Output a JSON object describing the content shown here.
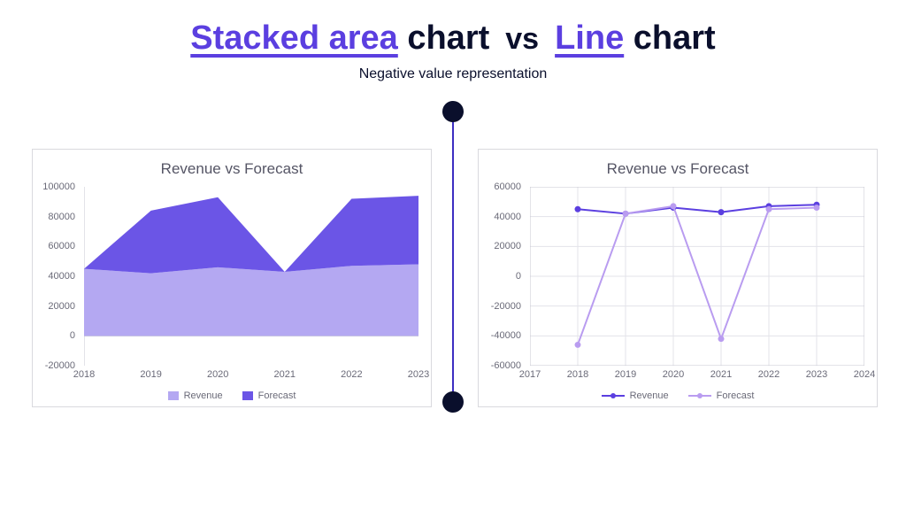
{
  "heading": {
    "left_link": "Stacked area",
    "left_rest": " chart",
    "vs": "vs",
    "right_link": "Line",
    "right_rest": " chart",
    "subtitle": "Negative value representation"
  },
  "chart_data": [
    {
      "type": "area",
      "title": "Revenue vs Forecast",
      "categories": [
        "2018",
        "2019",
        "2020",
        "2021",
        "2022",
        "2023"
      ],
      "series": [
        {
          "name": "Revenue",
          "values": [
            45000,
            42000,
            46000,
            43000,
            47000,
            48000
          ],
          "color": "#b4a8f2"
        },
        {
          "name": "Forecast",
          "values": [
            0,
            42000,
            47000,
            0,
            45000,
            46000
          ],
          "color": "#6b55e6"
        }
      ],
      "stacked": true,
      "xlabel": "",
      "ylabel": "",
      "ylim": [
        -20000,
        100000
      ],
      "y_ticks": [
        -20000,
        0,
        20000,
        40000,
        60000,
        80000,
        100000
      ],
      "grid": false,
      "legend_position": "bottom"
    },
    {
      "type": "line",
      "title": "Revenue vs Forecast",
      "categories": [
        "2018",
        "2019",
        "2020",
        "2021",
        "2022",
        "2023"
      ],
      "series": [
        {
          "name": "Revenue",
          "values": [
            45000,
            42000,
            46000,
            43000,
            47000,
            48000
          ],
          "color": "#5b3fe0"
        },
        {
          "name": "Forecast",
          "values": [
            -46000,
            42000,
            47000,
            -42000,
            45000,
            46000
          ],
          "color": "#b99cf0"
        }
      ],
      "xlabel": "",
      "ylabel": "",
      "xlim": [
        2017,
        2024
      ],
      "ylim": [
        -60000,
        60000
      ],
      "x_ticks": [
        2017,
        2018,
        2019,
        2020,
        2021,
        2022,
        2023,
        2024
      ],
      "y_ticks": [
        -60000,
        -40000,
        -20000,
        0,
        20000,
        40000,
        60000
      ],
      "grid": true,
      "legend_position": "bottom"
    }
  ]
}
